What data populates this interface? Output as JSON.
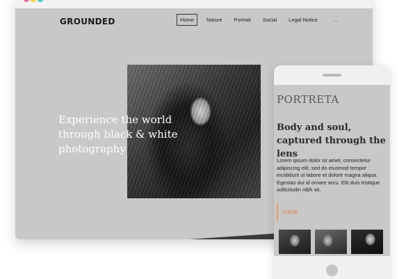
{
  "site": {
    "logo": "GROUNDED",
    "nav": [
      "Home",
      "Nature",
      "Portrait",
      "Social",
      "Legal Notice"
    ],
    "nav_active_index": 0,
    "nav_more": "...",
    "hero_title": "Experience the world through black & white photography"
  },
  "mobile": {
    "brand": "PORTRETA",
    "heading": "Body and soul, captured through the lens",
    "body": "Lorem ipsum dolor sit amet, consectetur adipiscing elit, sed do eiusmod tempor incididunt ut labore et dolore magna aliqua. Egestas dui id ornare arcu. Elit duis tristique sollicitudin nibh sit.",
    "cta": "VIEW"
  },
  "colors": {
    "background": "#c8c8c8",
    "accent": "#e07a45",
    "window_dots": [
      "#f06aa0",
      "#f5d03a",
      "#3fd0c8"
    ]
  },
  "icons": [
    "window-close-dot-icon",
    "window-minimize-dot-icon",
    "window-maximize-dot-icon"
  ]
}
